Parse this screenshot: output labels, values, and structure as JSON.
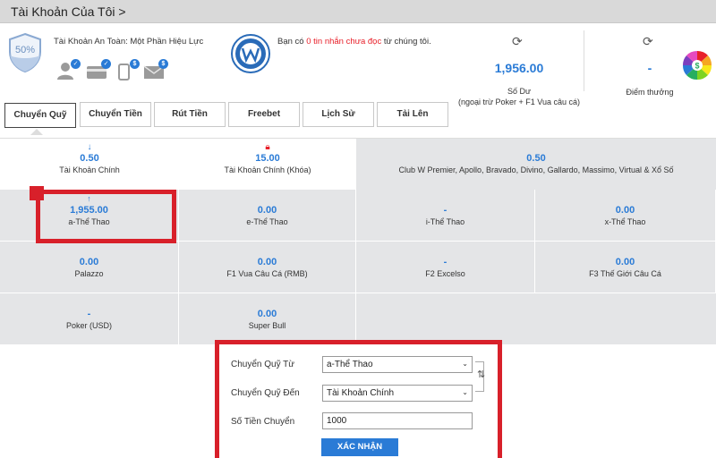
{
  "header": {
    "title": "Tài Khoản Của Tôi >"
  },
  "safety": {
    "percent": "50%",
    "label": "Tài Khoản An Toàn: Một Phần Hiệu Lực",
    "badge_symbol": "$"
  },
  "messages": {
    "prefix": "Bạn có",
    "count_text": "0 tin nhắn chưa đọc",
    "suffix": "từ chúng tôi."
  },
  "balance": {
    "value": "1,956.00",
    "label": "Số Dư",
    "note": "(ngoại trừ Poker + F1 Vua câu cá)"
  },
  "points": {
    "value": "-",
    "label": "Điểm thưởng"
  },
  "tabs": [
    {
      "label": "Chuyển Quỹ"
    },
    {
      "label": "Chuyển Tiền"
    },
    {
      "label": "Rút Tiền"
    },
    {
      "label": "Freebet"
    },
    {
      "label": "Lịch Sử"
    },
    {
      "label": "Tải Lên"
    }
  ],
  "summary": [
    {
      "value": "0.50",
      "label": "Tài Khoản Chính"
    },
    {
      "value": "15.00",
      "label": "Tài Khoản Chính (Khóa)"
    },
    {
      "value": "0.50",
      "label": "Club W Premier, Apollo, Bravado, Divino, Gallardo, Massimo, Virtual & Xổ Số"
    }
  ],
  "wallets": [
    {
      "value": "1,955.00",
      "label": "a-Thể Thao"
    },
    {
      "value": "0.00",
      "label": "e-Thể Thao"
    },
    {
      "value": "-",
      "label": "i-Thể Thao"
    },
    {
      "value": "0.00",
      "label": "x-Thể Thao"
    },
    {
      "value": "0.00",
      "label": "Palazzo"
    },
    {
      "value": "0.00",
      "label": "F1 Vua Câu Cá (RMB)"
    },
    {
      "value": "-",
      "label": "F2 Excelso"
    },
    {
      "value": "0.00",
      "label": "F3 Thế Giới Câu Cá"
    },
    {
      "value": "-",
      "label": "Poker (USD)"
    },
    {
      "value": "0.00",
      "label": "Super Bull"
    }
  ],
  "transfer": {
    "from_label": "Chuyển Quỹ Từ",
    "from_value": "a-Thể Thao",
    "to_label": "Chuyển Quỹ Đến",
    "to_value": "Tài Khoản Chính",
    "amount_label": "Số Tiền Chuyển",
    "amount_value": "1000",
    "submit_label": "XÁC NHẬN"
  },
  "colors": {
    "accent": "#2a7bd6",
    "highlight": "#d8202a",
    "grid_bg": "#e4e5e7",
    "header_bg": "#d9d9d9"
  },
  "icons": [
    "shield-icon",
    "user-icon",
    "card-icon",
    "phone-icon",
    "mail-icon",
    "w-logo-icon",
    "refresh-icon",
    "wheel-icon",
    "download-arrow-icon",
    "lock-icon",
    "upload-arrow-icon",
    "chevron-down-icon",
    "swap-icon"
  ]
}
